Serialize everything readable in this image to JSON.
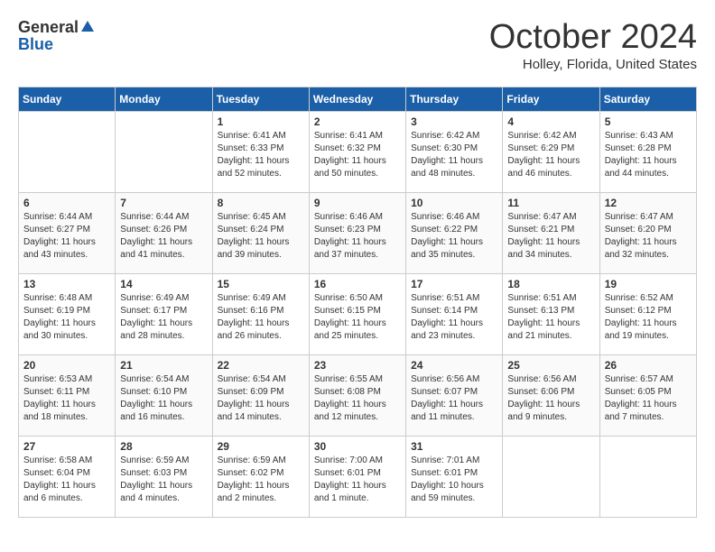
{
  "header": {
    "logo_general": "General",
    "logo_blue": "Blue",
    "title": "October 2024",
    "location": "Holley, Florida, United States"
  },
  "days_of_week": [
    "Sunday",
    "Monday",
    "Tuesday",
    "Wednesday",
    "Thursday",
    "Friday",
    "Saturday"
  ],
  "weeks": [
    [
      {
        "day": "",
        "empty": true
      },
      {
        "day": "",
        "empty": true
      },
      {
        "day": "1",
        "sunrise": "Sunrise: 6:41 AM",
        "sunset": "Sunset: 6:33 PM",
        "daylight": "Daylight: 11 hours and 52 minutes."
      },
      {
        "day": "2",
        "sunrise": "Sunrise: 6:41 AM",
        "sunset": "Sunset: 6:32 PM",
        "daylight": "Daylight: 11 hours and 50 minutes."
      },
      {
        "day": "3",
        "sunrise": "Sunrise: 6:42 AM",
        "sunset": "Sunset: 6:30 PM",
        "daylight": "Daylight: 11 hours and 48 minutes."
      },
      {
        "day": "4",
        "sunrise": "Sunrise: 6:42 AM",
        "sunset": "Sunset: 6:29 PM",
        "daylight": "Daylight: 11 hours and 46 minutes."
      },
      {
        "day": "5",
        "sunrise": "Sunrise: 6:43 AM",
        "sunset": "Sunset: 6:28 PM",
        "daylight": "Daylight: 11 hours and 44 minutes."
      }
    ],
    [
      {
        "day": "6",
        "sunrise": "Sunrise: 6:44 AM",
        "sunset": "Sunset: 6:27 PM",
        "daylight": "Daylight: 11 hours and 43 minutes."
      },
      {
        "day": "7",
        "sunrise": "Sunrise: 6:44 AM",
        "sunset": "Sunset: 6:26 PM",
        "daylight": "Daylight: 11 hours and 41 minutes."
      },
      {
        "day": "8",
        "sunrise": "Sunrise: 6:45 AM",
        "sunset": "Sunset: 6:24 PM",
        "daylight": "Daylight: 11 hours and 39 minutes."
      },
      {
        "day": "9",
        "sunrise": "Sunrise: 6:46 AM",
        "sunset": "Sunset: 6:23 PM",
        "daylight": "Daylight: 11 hours and 37 minutes."
      },
      {
        "day": "10",
        "sunrise": "Sunrise: 6:46 AM",
        "sunset": "Sunset: 6:22 PM",
        "daylight": "Daylight: 11 hours and 35 minutes."
      },
      {
        "day": "11",
        "sunrise": "Sunrise: 6:47 AM",
        "sunset": "Sunset: 6:21 PM",
        "daylight": "Daylight: 11 hours and 34 minutes."
      },
      {
        "day": "12",
        "sunrise": "Sunrise: 6:47 AM",
        "sunset": "Sunset: 6:20 PM",
        "daylight": "Daylight: 11 hours and 32 minutes."
      }
    ],
    [
      {
        "day": "13",
        "sunrise": "Sunrise: 6:48 AM",
        "sunset": "Sunset: 6:19 PM",
        "daylight": "Daylight: 11 hours and 30 minutes."
      },
      {
        "day": "14",
        "sunrise": "Sunrise: 6:49 AM",
        "sunset": "Sunset: 6:17 PM",
        "daylight": "Daylight: 11 hours and 28 minutes."
      },
      {
        "day": "15",
        "sunrise": "Sunrise: 6:49 AM",
        "sunset": "Sunset: 6:16 PM",
        "daylight": "Daylight: 11 hours and 26 minutes."
      },
      {
        "day": "16",
        "sunrise": "Sunrise: 6:50 AM",
        "sunset": "Sunset: 6:15 PM",
        "daylight": "Daylight: 11 hours and 25 minutes."
      },
      {
        "day": "17",
        "sunrise": "Sunrise: 6:51 AM",
        "sunset": "Sunset: 6:14 PM",
        "daylight": "Daylight: 11 hours and 23 minutes."
      },
      {
        "day": "18",
        "sunrise": "Sunrise: 6:51 AM",
        "sunset": "Sunset: 6:13 PM",
        "daylight": "Daylight: 11 hours and 21 minutes."
      },
      {
        "day": "19",
        "sunrise": "Sunrise: 6:52 AM",
        "sunset": "Sunset: 6:12 PM",
        "daylight": "Daylight: 11 hours and 19 minutes."
      }
    ],
    [
      {
        "day": "20",
        "sunrise": "Sunrise: 6:53 AM",
        "sunset": "Sunset: 6:11 PM",
        "daylight": "Daylight: 11 hours and 18 minutes."
      },
      {
        "day": "21",
        "sunrise": "Sunrise: 6:54 AM",
        "sunset": "Sunset: 6:10 PM",
        "daylight": "Daylight: 11 hours and 16 minutes."
      },
      {
        "day": "22",
        "sunrise": "Sunrise: 6:54 AM",
        "sunset": "Sunset: 6:09 PM",
        "daylight": "Daylight: 11 hours and 14 minutes."
      },
      {
        "day": "23",
        "sunrise": "Sunrise: 6:55 AM",
        "sunset": "Sunset: 6:08 PM",
        "daylight": "Daylight: 11 hours and 12 minutes."
      },
      {
        "day": "24",
        "sunrise": "Sunrise: 6:56 AM",
        "sunset": "Sunset: 6:07 PM",
        "daylight": "Daylight: 11 hours and 11 minutes."
      },
      {
        "day": "25",
        "sunrise": "Sunrise: 6:56 AM",
        "sunset": "Sunset: 6:06 PM",
        "daylight": "Daylight: 11 hours and 9 minutes."
      },
      {
        "day": "26",
        "sunrise": "Sunrise: 6:57 AM",
        "sunset": "Sunset: 6:05 PM",
        "daylight": "Daylight: 11 hours and 7 minutes."
      }
    ],
    [
      {
        "day": "27",
        "sunrise": "Sunrise: 6:58 AM",
        "sunset": "Sunset: 6:04 PM",
        "daylight": "Daylight: 11 hours and 6 minutes."
      },
      {
        "day": "28",
        "sunrise": "Sunrise: 6:59 AM",
        "sunset": "Sunset: 6:03 PM",
        "daylight": "Daylight: 11 hours and 4 minutes."
      },
      {
        "day": "29",
        "sunrise": "Sunrise: 6:59 AM",
        "sunset": "Sunset: 6:02 PM",
        "daylight": "Daylight: 11 hours and 2 minutes."
      },
      {
        "day": "30",
        "sunrise": "Sunrise: 7:00 AM",
        "sunset": "Sunset: 6:01 PM",
        "daylight": "Daylight: 11 hours and 1 minute."
      },
      {
        "day": "31",
        "sunrise": "Sunrise: 7:01 AM",
        "sunset": "Sunset: 6:01 PM",
        "daylight": "Daylight: 10 hours and 59 minutes."
      },
      {
        "day": "",
        "empty": true
      },
      {
        "day": "",
        "empty": true
      }
    ]
  ]
}
